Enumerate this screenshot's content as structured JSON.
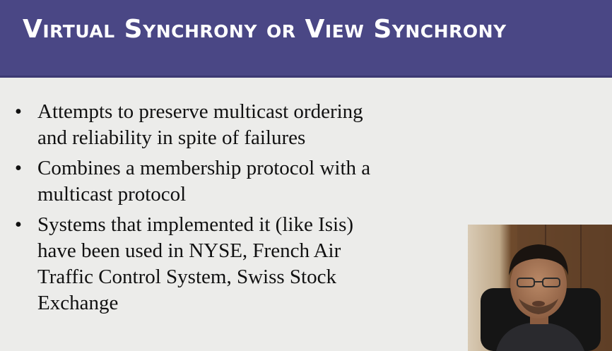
{
  "slide": {
    "title": "Virtual Synchrony or View Synchrony",
    "bullet_glyph": "•",
    "bullets": [
      {
        "line1": "Attempts to preserve multicast ordering",
        "line2": "and reliability in spite of failures"
      },
      {
        "line1": "Combines a membership protocol with a",
        "line2": "multicast protocol"
      },
      {
        "line1": "Systems that implemented it (like Isis)",
        "line2": "have been used in NYSE, French Air",
        "line3": "Traffic Control System, Swiss Stock",
        "line4": "Exchange"
      }
    ]
  },
  "colors": {
    "title_bar": "#4a4785",
    "background": "#ececea",
    "text": "#111111"
  }
}
